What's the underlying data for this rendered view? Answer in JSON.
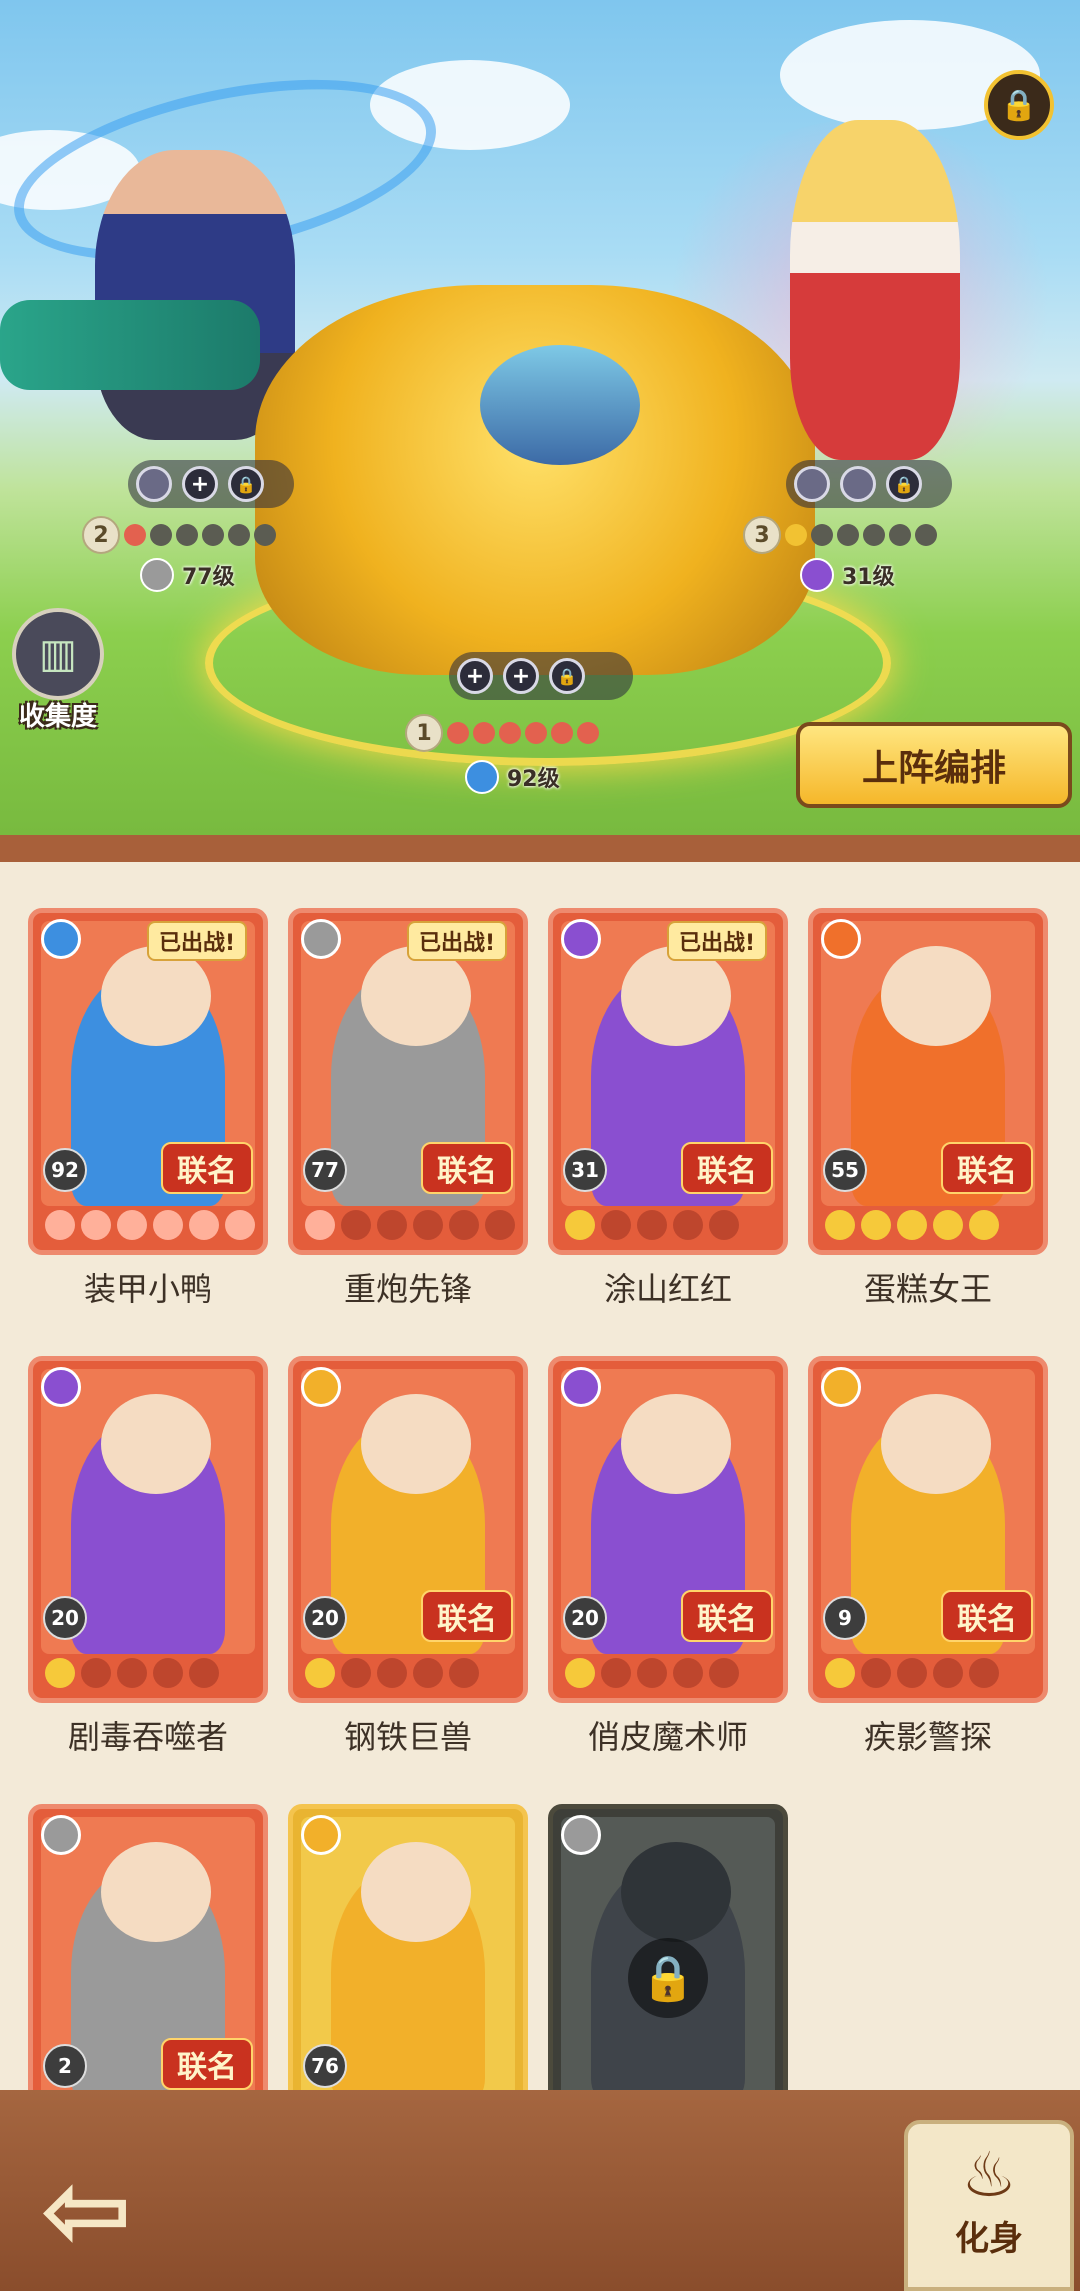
{
  "scene": {
    "collection_label": "收集度",
    "formation_button": "上阵编排",
    "slot_plus": "+",
    "slot_lock": "🔒",
    "heroes": [
      {
        "rank": "1",
        "level": "92级",
        "element": "water",
        "element_color": "#3d8fe0",
        "stars_filled": 6,
        "star_color": "#e3614f"
      },
      {
        "rank": "2",
        "level": "77级",
        "element": "sword",
        "element_color": "#9a9a9a",
        "stars_filled": 1,
        "star_color": "#e3614f"
      },
      {
        "rank": "3",
        "level": "31级",
        "element": "poison",
        "element_color": "#8a4fd0",
        "stars_filled": 1,
        "star_color": "#f2c232"
      }
    ]
  },
  "cards": [
    {
      "name": "装甲小鸭",
      "level": "92",
      "element": "water-icon",
      "element_color": "#3d8fe0",
      "deployed": "已出战!",
      "collab": "联名",
      "stars": 6,
      "star_style": "flame",
      "frame": "red"
    },
    {
      "name": "重炮先锋",
      "level": "77",
      "element": "sword-icon",
      "element_color": "#9a9a9a",
      "deployed": "已出战!",
      "collab": "联名",
      "stars": 1,
      "star_style": "flame",
      "frame": "red"
    },
    {
      "name": "涂山红红",
      "level": "31",
      "element": "poison-icon",
      "element_color": "#8a4fd0",
      "deployed": "已出战!",
      "collab": "联名",
      "stars": 1,
      "star_style": "star",
      "frame": "red"
    },
    {
      "name": "蛋糕女王",
      "level": "55",
      "element": "fire-icon",
      "element_color": "#f0702b",
      "deployed": "",
      "collab": "联名",
      "stars": 5,
      "star_style": "star",
      "frame": "red"
    },
    {
      "name": "剧毒吞噬者",
      "level": "20",
      "element": "poison-icon",
      "element_color": "#8a4fd0",
      "deployed": "",
      "collab": "",
      "stars": 1,
      "star_style": "star",
      "frame": "red"
    },
    {
      "name": "钢铁巨兽",
      "level": "20",
      "element": "lightning-icon",
      "element_color": "#f2b02a",
      "deployed": "",
      "collab": "联名",
      "stars": 1,
      "star_style": "star",
      "frame": "red"
    },
    {
      "name": "俏皮魔术师",
      "level": "20",
      "element": "poison-icon",
      "element_color": "#8a4fd0",
      "deployed": "",
      "collab": "联名",
      "stars": 1,
      "star_style": "star",
      "frame": "red"
    },
    {
      "name": "疾影警探",
      "level": "9",
      "element": "lightning-icon",
      "element_color": "#f2b02a",
      "deployed": "",
      "collab": "联名",
      "stars": 1,
      "star_style": "star",
      "frame": "red"
    },
    {
      "name": "",
      "level": "2",
      "element": "sword-icon",
      "element_color": "#9a9a9a",
      "deployed": "",
      "collab": "联名",
      "stars": 0,
      "star_style": "star",
      "frame": "red"
    },
    {
      "name": "",
      "level": "76",
      "element": "lightning-icon",
      "element_color": "#f2b02a",
      "deployed": "",
      "collab": "",
      "stars": 0,
      "star_style": "star",
      "frame": "gold"
    },
    {
      "name": "",
      "level": "",
      "element": "sword-icon",
      "element_color": "#9a9a9a",
      "deployed": "",
      "collab": "",
      "stars": 0,
      "star_style": "star",
      "frame": "locked"
    }
  ],
  "bottom": {
    "back_glyph": "⇦",
    "transform_label": "化身",
    "transform_glyph": "♨"
  }
}
